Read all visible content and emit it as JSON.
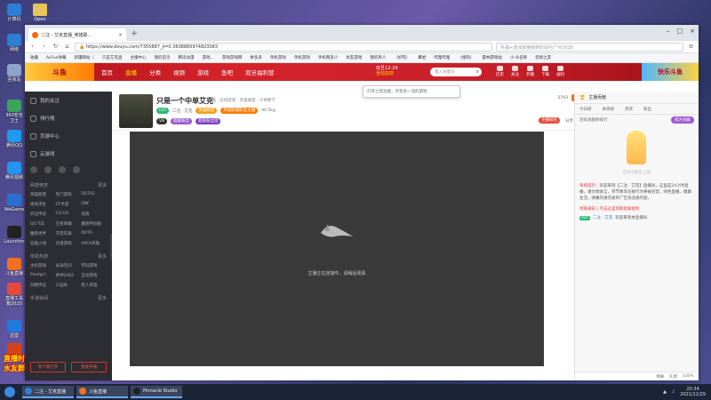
{
  "desktop": {
    "icons": [
      "计算机",
      "网络",
      "回收站",
      "360安全卫士",
      "腾讯QQ",
      "腾讯视频",
      "WeGame",
      "Launcher",
      "斗鱼直播",
      "直播工具箱2020",
      "迅雷",
      "鲁大师"
    ],
    "icons_col2": [
      "Open"
    ],
    "promo_line1": "直播时间：早10点~下3点",
    "promo_line2": "水友群：362583518"
  },
  "browser": {
    "tab_title": "二注 - 艾克直播_英雄联...",
    "url": "https://www.douyu.com/7355887_ji=0.3638885974823583",
    "search_placeholder": "补漏+遗派剑接受新阶段与广州2026",
    "bookmarks": [
      "收藏",
      "AcFun弹幕",
      "新疆网站（",
      "只是艾克直",
      "主播中心",
      "我的首页",
      "腾讯动漫",
      "游戏...",
      "游戏游戏网",
      "拼多多",
      "单机游戏",
      "单机游戏",
      "手机网多少",
      "坑友游戏",
      "我的男人",
      "（好嗒）",
      "攀岩",
      "哔哩哔哩",
      "（搜狗）",
      "雷林游戏站",
      "小·众名称",
      "装修之友"
    ]
  },
  "douyu": {
    "logo": "斗鱼",
    "nav": [
      "首页",
      "直播",
      "分类",
      "视频",
      "游戏",
      "鱼吧",
      "双旦福利营"
    ],
    "event_line1": "双旦12-24",
    "event_line2": "全站狂欢",
    "search_placeholder": "输入关键词",
    "user_icons": [
      "历史",
      "关注",
      "开播",
      "下载",
      "福利"
    ],
    "mascot": "快乐斗鱼",
    "tooltip": "打开之后功能，享受多一流的游戏"
  },
  "sidebar": {
    "items": [
      "我的关注",
      "排行榜",
      "页游中心",
      "云游戏"
    ],
    "small_label": "直播",
    "section_games": "网游竞技",
    "games": [
      "英雄联盟",
      "热门游戏",
      "DOTA2",
      "绝地求生",
      "CF手游",
      "DNF",
      "炉石传说",
      "CS:GO",
      "逃跑",
      "QQ飞车",
      "王者荣耀",
      "魔兽怀旧服",
      "魔兽世界",
      "守望先锋",
      "DOTA",
      "穿越火线",
      "问道游戏",
      "APEX英雄"
    ],
    "section_mobile": "单机热游",
    "mobile": [
      "主机游戏",
      "永劫无间",
      "怀旧游戏",
      "Pixelgirl",
      "原神2062",
      "互动游戏",
      "剑网传说",
      "三国杀",
      "猎人英雄"
    ],
    "section_hand": "手游休闲",
    "btn_client": "客户端打开",
    "btn_broadcast": "我要开播",
    "more": "更多"
  },
  "room": {
    "title": "只是一个中单艾克",
    "tags": "英雄 · 双排游戏 · 英雄联盟 · 大神教学",
    "line2_pill": "LV2",
    "line2_text": "二注 · 艾克",
    "line2_badge": "英雄联盟",
    "line2_badge2": "英雄联盟职业主播",
    "followers": "40.5kg",
    "vip": "V8",
    "badge_a": "超级粉丝",
    "badge_b": "超级粉丝团",
    "views": "3793",
    "follow": "关注",
    "rank_badge": "主播排名",
    "share": "分享",
    "report": "举报",
    "player_msg": "主播正在连接中，请稍后观看"
  },
  "chat": {
    "header": "主播贡献",
    "tabs": [
      "今日榜",
      "本周榜",
      "贵宾",
      "粉丝"
    ],
    "rank_label": "连续贡献榜排行",
    "rank_button": "成为贡献",
    "empty_text": "还未有粉丝上榜",
    "sys_label": "系统提示：",
    "sys_text": "欢迎来到【二注 · 艾克】直播间，这里是24小时直播，请文明发言，带节奏等违规行为将被封禁，绿色直播，健康生活，弹幕内请勿发布广告等违规内容。",
    "gift_line": "领取通知 | 点击这里领取超级福利",
    "user_badge": "LV5",
    "user_name": "二注 · 艾克",
    "user_text": "欢迎来到本直播间",
    "foot": [
      "弹幕",
      "礼物",
      "100%"
    ]
  },
  "taskbar": {
    "apps": [
      "二注 - 艾克直播",
      "斗鱼直播",
      "Pinnacle Studio"
    ],
    "time": "20:34",
    "date": "2021/12/29"
  },
  "colors": {
    "douyu_red": "#c71f2a",
    "accent_orange": "#f37021",
    "player_bg": "#3a3a3a"
  }
}
